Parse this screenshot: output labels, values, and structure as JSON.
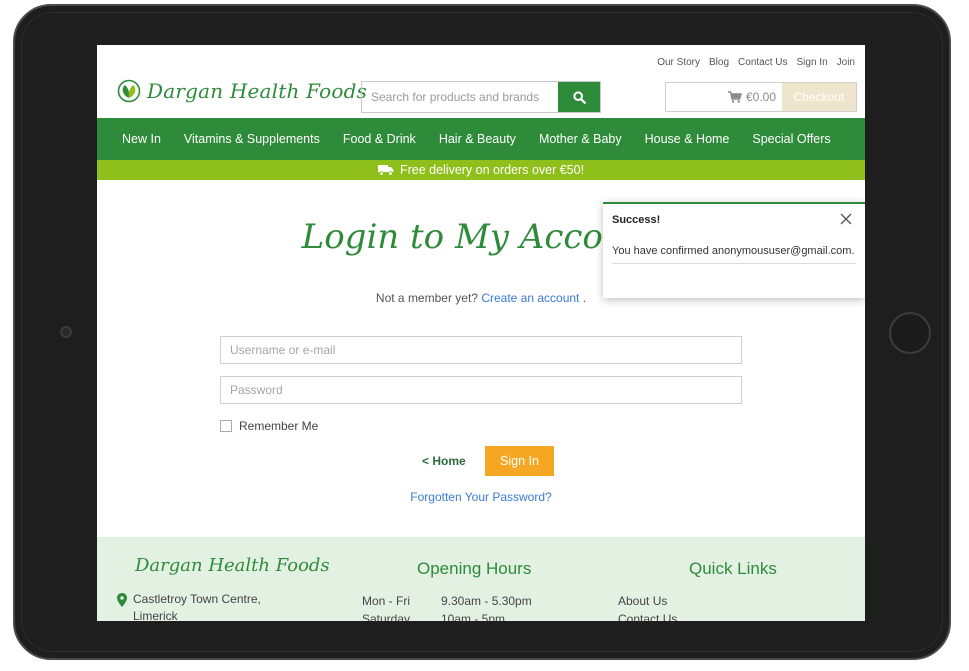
{
  "top_links": [
    "Our Story",
    "Blog",
    "Contact Us",
    "Sign In",
    "Join"
  ],
  "logo": {
    "text": "Dargan Health Foods"
  },
  "search": {
    "placeholder": "Search for products and brands",
    "icon": "search-icon"
  },
  "cart": {
    "total": "€0.00",
    "checkout_label": "Checkout"
  },
  "nav": [
    "New In",
    "Vitamins & Supplements",
    "Food & Drink",
    "Hair & Beauty",
    "Mother & Baby",
    "House & Home",
    "Special Offers"
  ],
  "delivery_banner": "Free delivery on orders over €50!",
  "login": {
    "title": "Login to My Account",
    "not_member_prefix": "Not a member yet?",
    "create_account": "Create an account",
    "not_member_suffix": ".",
    "username_placeholder": "Username or e-mail",
    "password_placeholder": "Password",
    "remember_me": "Remember Me",
    "home_link": "< Home",
    "sign_in_label": "Sign In",
    "forgot_password": "Forgotten Your Password?"
  },
  "footer": {
    "brand": "Dargan Health Foods",
    "address_line1": "Castletroy Town Centre,",
    "address_line2": "Limerick",
    "hours_title": "Opening Hours",
    "hours": [
      {
        "day": "Mon - Fri",
        "time": "9.30am - 5.30pm"
      },
      {
        "day": "Saturday",
        "time": "10am - 5pm"
      }
    ],
    "quick_links_title": "Quick Links",
    "quick_links": [
      "About Us",
      "Contact Us"
    ]
  },
  "toast": {
    "title": "Success!",
    "message": "You have confirmed anonymoususer@gmail.com."
  },
  "colors": {
    "brand_green": "#2e8b3a",
    "delivery_green": "#8fbf1a",
    "signin_orange": "#f5a623",
    "link_blue": "#3a7bd5"
  }
}
